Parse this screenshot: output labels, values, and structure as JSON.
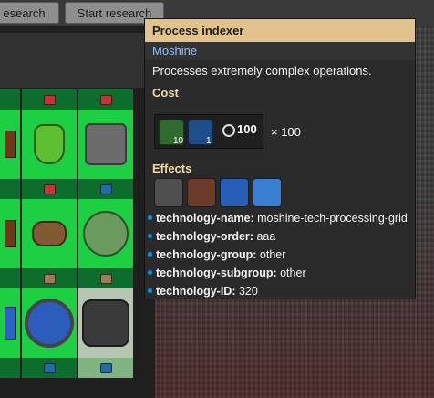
{
  "top_buttons": {
    "left_label": "esearch",
    "start_label": "Start research"
  },
  "tooltip": {
    "title": "Process indexer",
    "subtitle": "Moshine",
    "description": "Processes extremely complex operations.",
    "cost_header": "Cost",
    "cost_items": [
      {
        "icon": "science-pack-green-icon",
        "count": "10"
      },
      {
        "icon": "chip-blue-icon",
        "count": "1"
      }
    ],
    "time": "100",
    "multiplier": "× 100",
    "effects_header": "Effects",
    "effects_icons": [
      "robot-icon",
      "circuit-brown-icon",
      "solar-panel-icon",
      "processor-icon"
    ],
    "properties": [
      {
        "key": "technology-name:",
        "value": "moshine-tech-processing-grid"
      },
      {
        "key": "technology-order:",
        "value": "aaa"
      },
      {
        "key": "technology-group:",
        "value": "other"
      },
      {
        "key": "technology-subgroup:",
        "value": "other"
      },
      {
        "key": "technology-ID:",
        "value": "320"
      }
    ]
  },
  "colors": {
    "title_bg": "#e2c38e",
    "tile_green": "#1ccf43",
    "label_green": "#0d6d2c",
    "link_blue": "#8dc3ff"
  }
}
